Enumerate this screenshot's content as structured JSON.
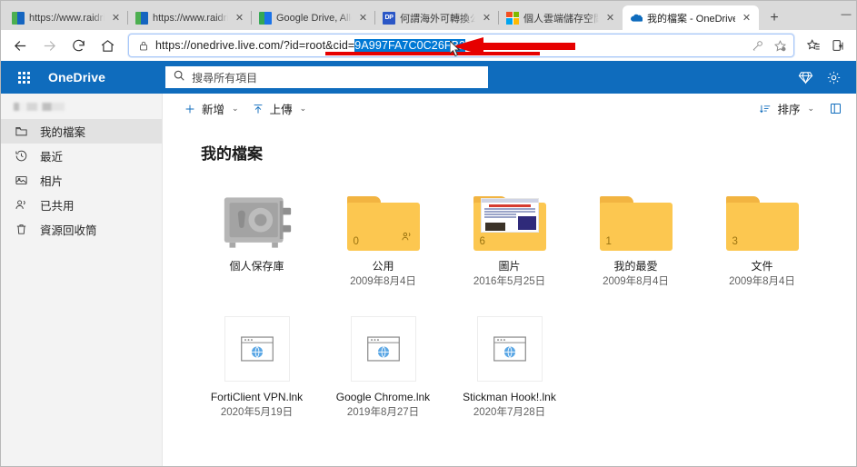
{
  "browser": {
    "tabs": [
      {
        "title": "https://www.raidrive.co",
        "favicon": "raidrive-icon",
        "active": false
      },
      {
        "title": "https://www.raidrive.co",
        "favicon": "raidrive-icon",
        "active": false
      },
      {
        "title": "Google Drive, Allowed",
        "favicon": "google-drive-icon",
        "active": false
      },
      {
        "title": "何謂海外可轉換公司債",
        "favicon": "dp-icon",
        "active": false
      },
      {
        "title": "個人雲端儲存空間 – M",
        "favicon": "microsoft-icon",
        "active": false
      },
      {
        "title": "我的檔案 - OneDrive",
        "favicon": "onedrive-icon",
        "active": true
      }
    ],
    "new_tab_label": "+",
    "minimize_label": "—",
    "close_tab_label": "✕",
    "nav": {
      "back": "←",
      "forward": "→",
      "refresh": "⟳",
      "home": "⌂"
    },
    "address": {
      "url_prefix": "https://onedrive.live.com/?id=root&cid=",
      "url_selected": "9A997FA7C0C26FB2",
      "lock_icon": "lock-icon"
    },
    "omnibox_icons": [
      "key-icon",
      "add-favorite-icon"
    ],
    "toolbar_icons": [
      "favorites-icon",
      "collections-icon"
    ]
  },
  "suitebar": {
    "waffle_icon": "app-launcher-icon",
    "brand": "OneDrive",
    "search_placeholder": "搜尋所有項目",
    "search_icon": "search-icon",
    "premium_icon": "diamond-icon",
    "settings_icon": "gear-icon",
    "background": "#0f6cbd"
  },
  "sidebar": {
    "account_name_redacted": "",
    "items": [
      {
        "label": "我的檔案",
        "icon": "folder-icon",
        "active": true
      },
      {
        "label": "最近",
        "icon": "clock-icon",
        "active": false
      },
      {
        "label": "相片",
        "icon": "photo-icon",
        "active": false
      },
      {
        "label": "已共用",
        "icon": "people-icon",
        "active": false
      },
      {
        "label": "資源回收筒",
        "icon": "trash-icon",
        "active": false
      }
    ]
  },
  "commandbar": {
    "new_label": "新增",
    "upload_label": "上傳",
    "sort_label": "排序",
    "new_icon": "plus-icon",
    "upload_icon": "upload-icon",
    "sort_icon": "sort-icon",
    "view_icon": "view-options-icon",
    "chevron": "⌄"
  },
  "main": {
    "page_title": "我的檔案",
    "items": [
      {
        "name": "個人保存庫",
        "date": "",
        "type": "vault",
        "count": ""
      },
      {
        "name": "公用",
        "date": "2009年8月4日",
        "type": "folder-shared",
        "count": "0"
      },
      {
        "name": "圖片",
        "date": "2016年5月25日",
        "type": "folder-photo",
        "count": "6"
      },
      {
        "name": "我的最愛",
        "date": "2009年8月4日",
        "type": "folder",
        "count": "1"
      },
      {
        "name": "文件",
        "date": "2009年8月4日",
        "type": "folder",
        "count": "3"
      },
      {
        "name": "FortiClient VPN.lnk",
        "date": "2020年5月19日",
        "type": "lnk",
        "count": ""
      },
      {
        "name": "Google Chrome.lnk",
        "date": "2019年8月27日",
        "type": "lnk",
        "count": ""
      },
      {
        "name": "Stickman Hook!.lnk",
        "date": "2020年7月28日",
        "type": "lnk",
        "count": ""
      }
    ]
  },
  "annotation": {
    "arrow_color": "#e60000",
    "arrow_direction": "left",
    "underline_color": "#e60000"
  }
}
